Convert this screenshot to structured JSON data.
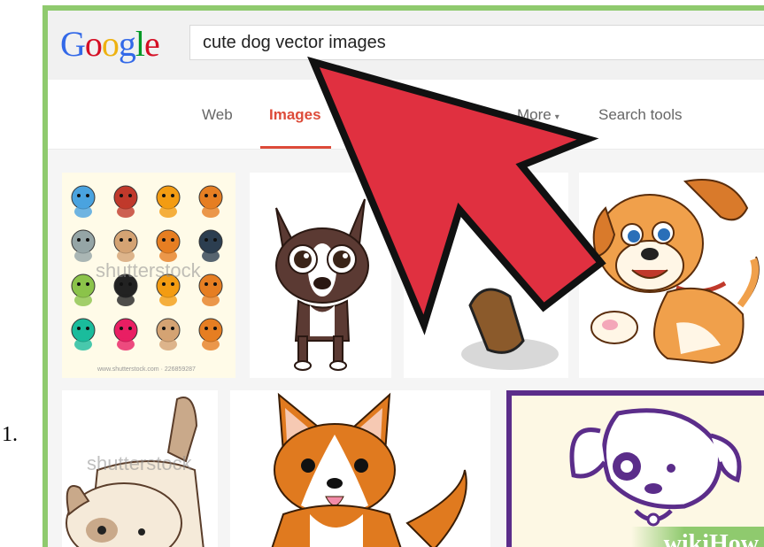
{
  "step_number": "1.",
  "logo": {
    "text": "Google",
    "letters": [
      {
        "ch": "G",
        "color": "#3369e8"
      },
      {
        "ch": "o",
        "color": "#d50f25"
      },
      {
        "ch": "o",
        "color": "#eeb211"
      },
      {
        "ch": "g",
        "color": "#3369e8"
      },
      {
        "ch": "l",
        "color": "#009925"
      },
      {
        "ch": "e",
        "color": "#d50f25"
      }
    ]
  },
  "search": {
    "value": "cute dog vector images"
  },
  "tabs": [
    {
      "label": "Web",
      "active": false
    },
    {
      "label": "Images",
      "active": true
    },
    {
      "label": "More",
      "active": false,
      "caret": "▾"
    },
    {
      "label": "Search tools",
      "active": false
    }
  ],
  "results": {
    "watermark_shutterstock": "shutterstock",
    "footer_text": "www.shutterstock.com · 226859287"
  },
  "wikihow": {
    "text": "wikiHow"
  },
  "colors": {
    "frame_green": "#8fca6e",
    "arrow_red": "#e03040",
    "tab_active": "#dd4b39"
  }
}
